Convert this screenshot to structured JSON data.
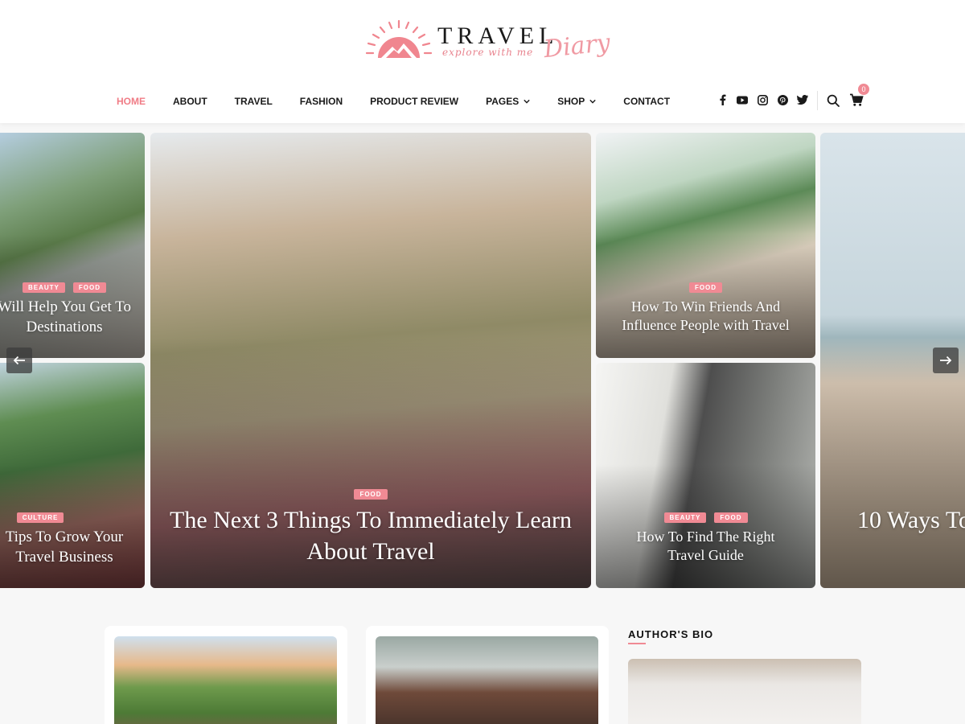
{
  "brand": {
    "title": "TRAVEL",
    "tagline": "explore with me",
    "script": "Diary",
    "accent": "#f08a94"
  },
  "nav": {
    "items": [
      {
        "label": "HOME",
        "active": true
      },
      {
        "label": "ABOUT"
      },
      {
        "label": "TRAVEL"
      },
      {
        "label": "FASHION"
      },
      {
        "label": "PRODUCT REVIEW"
      },
      {
        "label": "PAGES",
        "dropdown": true
      },
      {
        "label": "SHOP",
        "dropdown": true
      },
      {
        "label": "CONTACT"
      }
    ],
    "social_icons": [
      "facebook-icon",
      "youtube-icon",
      "instagram-icon",
      "pinterest-icon",
      "twitter-icon"
    ],
    "cart_count": "0"
  },
  "slider": {
    "left_top": {
      "tags": [
        "BEAUTY",
        "FOOD"
      ],
      "title_lines": [
        "Will Help You Get To",
        "Destinations"
      ]
    },
    "left_bottom": {
      "tags": [
        "CULTURE"
      ],
      "title_lines": [
        "Tips To Grow Your",
        "Travel Business"
      ]
    },
    "main": {
      "tags": [
        "FOOD"
      ],
      "title_lines": [
        "The Next 3 Things To Immediately Learn",
        "About Travel"
      ]
    },
    "right_top": {
      "tags": [
        "FOOD"
      ],
      "title_lines": [
        "How To Win Friends And",
        "Influence People with Travel"
      ]
    },
    "right_bottom": {
      "tags": [
        "BEAUTY",
        "FOOD"
      ],
      "title_lines": [
        "How To Find The Right",
        "Travel Guide"
      ]
    },
    "far_right": {
      "title_lines": [
        "10 Ways To"
      ]
    }
  },
  "sidebar": {
    "bio_title": "AUTHOR'S BIO"
  }
}
